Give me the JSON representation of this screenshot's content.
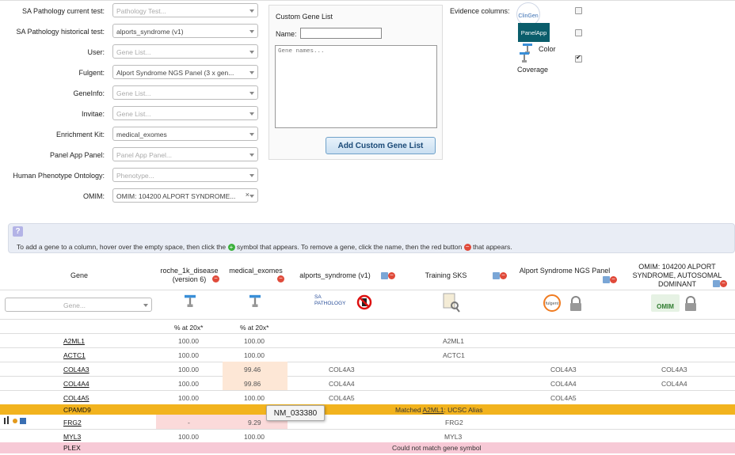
{
  "form": {
    "fields": [
      {
        "label": "SA Pathology current test:",
        "value": "Pathology Test...",
        "placeholder": true,
        "clear": false
      },
      {
        "label": "SA Pathology historical test:",
        "value": "alports_syndrome (v1)",
        "placeholder": false,
        "clear": false
      },
      {
        "label": "User:",
        "value": "Gene List...",
        "placeholder": true,
        "clear": false
      },
      {
        "label": "Fulgent:",
        "value": "Alport Syndrome NGS Panel (3 x gen...",
        "placeholder": false,
        "clear": false
      },
      {
        "label": "GeneInfo:",
        "value": "Gene List...",
        "placeholder": true,
        "clear": false
      },
      {
        "label": "Invitae:",
        "value": "Gene List...",
        "placeholder": true,
        "clear": false
      },
      {
        "label": "Enrichment Kit:",
        "value": "medical_exomes",
        "placeholder": false,
        "clear": false
      },
      {
        "label": "Panel App Panel:",
        "value": "Panel App Panel...",
        "placeholder": true,
        "clear": false
      },
      {
        "label": "Human Phenotype Ontology:",
        "value": "Phenotype...",
        "placeholder": true,
        "clear": false
      },
      {
        "label": "OMIM:",
        "value": "OMIM: 104200 ALPORT SYNDROME...",
        "placeholder": false,
        "clear": true
      }
    ]
  },
  "custom_gene_list": {
    "title": "Custom Gene List",
    "name_label": "Name:",
    "textarea_placeholder": "Gene names...",
    "add_button": "Add Custom Gene List"
  },
  "evidence": {
    "label": "Evidence columns:",
    "clingen_text": "ClinGen",
    "panelapp_text": "PanelApp",
    "color_label": "Color",
    "coverage_label": "Coverage"
  },
  "help": {
    "text_a": "To add a gene to a column, hover over the empty space, then click the",
    "text_b": "symbol that appears. To remove a gene, click the name, then the red button",
    "text_c": "that appears."
  },
  "table": {
    "headers": {
      "gene": "Gene",
      "roche": "roche_1k_disease (version 6)",
      "medical": "medical_exomes",
      "alports": "alports_syndrome (v1)",
      "training": "Training SKS",
      "fulgent": "Alport Syndrome NGS Panel",
      "omim": "OMIM: 104200 ALPORT SYNDROME, AUTOSOMAL DOMINANT"
    },
    "gene_select_placeholder": "Gene...",
    "sa_logo": "SA PATHOLOGY",
    "fulgent_logo": "fulgent",
    "omim_logo": "OMIM",
    "coverage_label_1": "% at 20x*",
    "coverage_label_2": "% at 20x*",
    "rows": [
      {
        "gene": "A2ML1",
        "roche": "100.00",
        "medical": "100.00",
        "alports": "",
        "training": "A2ML1",
        "fulgent": "",
        "omim": ""
      },
      {
        "gene": "ACTC1",
        "roche": "100.00",
        "medical": "100.00",
        "alports": "",
        "training": "ACTC1",
        "fulgent": "",
        "omim": ""
      },
      {
        "gene": "COL4A3",
        "roche": "100.00",
        "medical": "99.46",
        "alports": "COL4A3",
        "training": "",
        "fulgent": "COL4A3",
        "omim": "COL4A3"
      },
      {
        "gene": "COL4A4",
        "roche": "100.00",
        "medical": "99.86",
        "alports": "COL4A4",
        "training": "",
        "fulgent": "COL4A4",
        "omim": "COL4A4"
      },
      {
        "gene": "COL4A5",
        "roche": "100.00",
        "medical": "100.00",
        "alports": "COL4A5",
        "training": "",
        "fulgent": "COL4A5",
        "omim": ""
      }
    ],
    "cpamd9": {
      "gene": "CPAMD9",
      "msg_a": "Matched ",
      "msg_link": "A2ML1",
      "msg_b": ": UCSC Alias"
    },
    "frg2": {
      "gene": "FRG2",
      "roche": "-",
      "medical": "9.29",
      "training": "FRG2"
    },
    "myl3": {
      "gene": "MYL3",
      "roche": "100.00",
      "medical": "100.00",
      "training": "MYL3"
    },
    "plex": {
      "gene": "PLEX",
      "msg": "Could not match gene symbol"
    },
    "tooltip": "NM_033380"
  }
}
